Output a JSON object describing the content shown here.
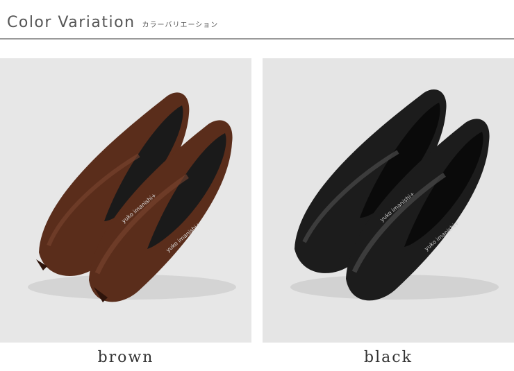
{
  "header": {
    "title": "Color Variation",
    "subtitle": "カラーバリエーション"
  },
  "variants": [
    {
      "label": "brown",
      "color": "#5a2d1b",
      "highlight": "#7a4430",
      "shadow": "#2e140b",
      "background": "#e6e6e6"
    },
    {
      "label": "black",
      "color": "#1c1c1c",
      "highlight": "#3a3a3a",
      "shadow": "#050505",
      "background": "#e4e4e4"
    }
  ],
  "insole_brand": "yuko imanishi+"
}
